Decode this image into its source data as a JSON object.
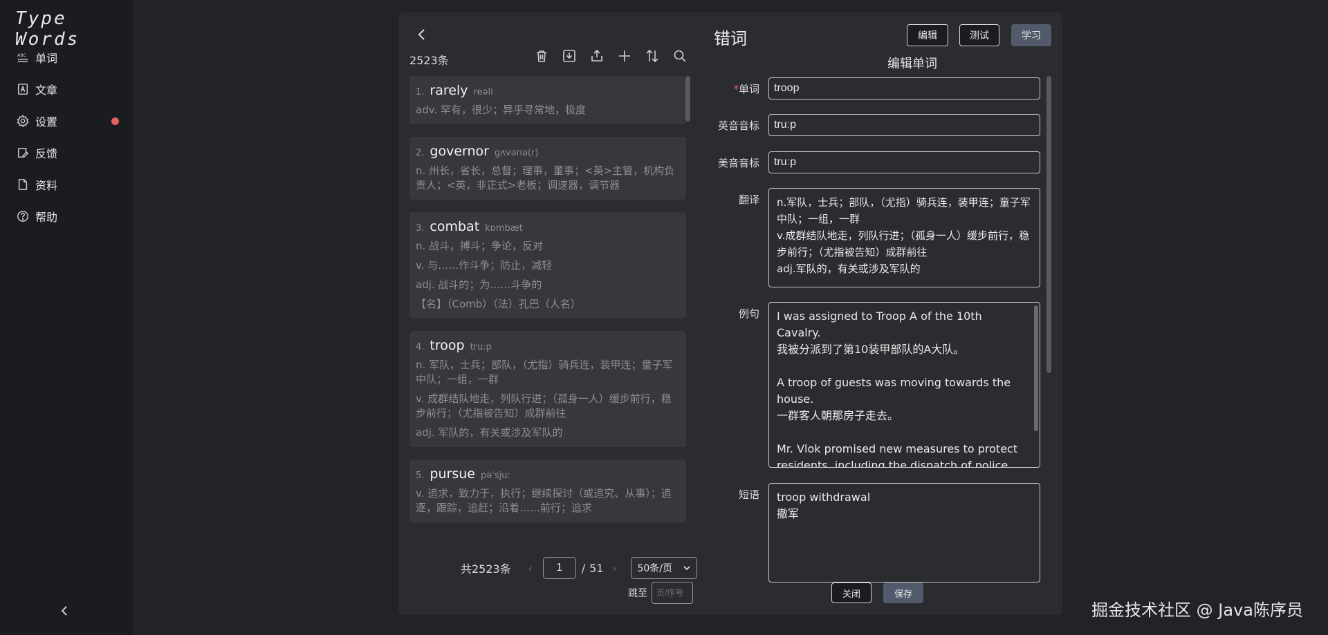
{
  "sidebar": {
    "logo": "Type Words",
    "items": [
      {
        "label": "单词",
        "icon": "abc-icon"
      },
      {
        "label": "文章",
        "icon": "article-icon"
      },
      {
        "label": "设置",
        "icon": "gear-icon",
        "badge_color": "#e5615f"
      },
      {
        "label": "反馈",
        "icon": "feedback-icon"
      },
      {
        "label": "资料",
        "icon": "file-icon"
      },
      {
        "label": "帮助",
        "icon": "help-icon"
      }
    ]
  },
  "list": {
    "count": "2523条",
    "toolbar_icons": [
      "trash-icon",
      "import-icon",
      "export-icon",
      "plus-icon",
      "sort-icon",
      "search-icon"
    ],
    "words": [
      {
        "index": "1.",
        "word": "rarely",
        "phonetic": "reəli",
        "trans": [
          "adv. 罕有，很少；异乎寻常地，极度"
        ]
      },
      {
        "index": "2.",
        "word": "governor",
        "phonetic": "gʌvənə(r)",
        "trans": [
          "n. 州长，省长，总督；理事，董事；<英>主管，机构负责人；<英，非正式>老板；调速器，调节器"
        ]
      },
      {
        "index": "3.",
        "word": "combat",
        "phonetic": "kɒmbæt",
        "trans": [
          "n. 战斗，搏斗；争论，反对",
          "v. 与……作斗争；防止，减轻",
          "adj. 战斗的；为……斗争的",
          "【名】（Comb）（法）孔巴（人名）"
        ]
      },
      {
        "index": "4.",
        "word": "troop",
        "phonetic": "truːp",
        "trans": [
          "n. 军队，士兵；部队，（尤指）骑兵连，装甲连；童子军中队；一组，一群",
          "v. 成群结队地走，列队行进；（孤身一人）缓步前行，稳步前行；（尤指被告知）成群前往",
          "adj. 军队的，有关或涉及军队的"
        ]
      },
      {
        "index": "5.",
        "word": "pursue",
        "phonetic": "pəˈsjuː",
        "trans": [
          "v. 追求，致力于，执行；继续探讨（或追究、从事）；追逐，跟踪，追赶；沿着……前行；追求"
        ]
      }
    ]
  },
  "pagination": {
    "total": "共2523条",
    "prev": "‹",
    "next": "›",
    "current": "1",
    "separator": "/",
    "pages": "51",
    "page_size": "50条/页",
    "jump_label": "跳至",
    "jump_placeholder": "页/序号"
  },
  "editor": {
    "title": "错词",
    "buttons": {
      "edit": "编辑",
      "test": "测试",
      "learn": "学习"
    },
    "form_title": "编辑单词",
    "labels": {
      "word": "单词",
      "uk": "英音音标",
      "us": "美音音标",
      "trans": "翻译",
      "example": "例句",
      "phrase": "短语"
    },
    "required_mark": "*",
    "fields": {
      "word": "troop",
      "uk": "truːp",
      "us": "truːp",
      "trans": "n.军队，士兵；部队，（尤指）骑兵连，装甲连；童子军中队；一组，一群\nv.成群结队地走，列队行进；（孤身一人）缓步前行，稳步前行；（尤指被告知）成群前往\nadj.军队的，有关或涉及军队的",
      "example": "I was assigned to Troop A of the 10th Cavalry.\n我被分派到了第10装甲部队的A大队。\n\nA troop of guests was moving towards the house.\n一群客人朝那房子走去。\n\nMr. Vlok promised new measures to protect residents, including the dispatch of police and troop reinforcements.",
      "phrase": "troop withdrawal\n撤军"
    },
    "close": "关闭",
    "save": "保存"
  },
  "watermark": "掘金技术社区 @ Java陈序员"
}
